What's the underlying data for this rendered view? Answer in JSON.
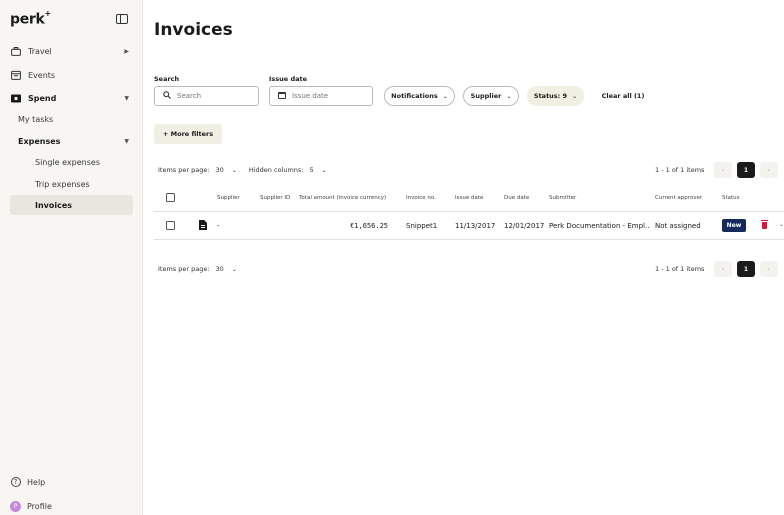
{
  "app": {
    "logo": "perk",
    "logo_sup": "+"
  },
  "sidebar": {
    "travel": "Travel",
    "events": "Events",
    "spend": "Spend",
    "my_tasks": "My tasks",
    "expenses": "Expenses",
    "single_expenses": "Single expenses",
    "trip_expenses": "Trip expenses",
    "invoices": "Invoices",
    "help": "Help",
    "profile": "Profile",
    "profile_initial": "P"
  },
  "page": {
    "title": "Invoices"
  },
  "filters": {
    "search_label": "Search",
    "search_placeholder": "Search",
    "issue_date_label": "Issue date",
    "issue_date_placeholder": "Issue date",
    "notifications": "Notifications",
    "supplier": "Supplier",
    "status": "Status: 9",
    "clear_all": "Clear all (1)",
    "more_filters": "+ More filters"
  },
  "pagination": {
    "items_per_page_label": "Items per page:",
    "items_per_page_value": "30",
    "hidden_columns_label": "Hidden columns:",
    "hidden_columns_value": "5",
    "range": "1 - 1 of 1 items",
    "current_page": "1",
    "prev": "‹",
    "next": "›"
  },
  "table": {
    "columns": {
      "supplier": "Supplier",
      "supplier_id": "Supplier ID",
      "total_amount": "Total amount (invoice currency)",
      "invoice_no": "Invoice no.",
      "issue_date": "Issue date",
      "due_date": "Due date",
      "submitter": "Submitter",
      "current_approver": "Current approver",
      "status": "Status"
    },
    "rows": [
      {
        "supplier": "-",
        "supplier_id": "",
        "total_amount": "€1,656.25",
        "invoice_no": "Snippet1",
        "issue_date": "11/13/2017",
        "due_date": "12/01/2017",
        "submitter": "Perk Documentation - Empl...",
        "current_approver": "Not assigned",
        "status": "New"
      }
    ]
  },
  "colors": {
    "status_new": "#142a5c",
    "delete": "#d9163a",
    "active_pill": "#f0efe3"
  }
}
